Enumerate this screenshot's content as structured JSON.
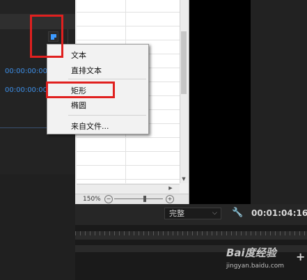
{
  "left_panel": {
    "timecodes": [
      "00:00:00:00",
      "00:00:00:00"
    ]
  },
  "context_menu": {
    "items": {
      "text": "文本",
      "vertical_text": "直排文本",
      "rectangle": "矩形",
      "ellipse": "椭圆",
      "from_file": "来自文件..."
    }
  },
  "document": {
    "zoom": "150%"
  },
  "bottom_controls": {
    "fit_select_value": "完整",
    "duration": "00:01:04:16"
  },
  "watermark": {
    "brand": "Bai度经验",
    "url": "jingyan.baidu.com"
  },
  "icons": {
    "new_item": "new-item-icon",
    "wrench": "wrench-icon",
    "add": "plus-icon"
  },
  "colors": {
    "timecode": "#3d8ee6",
    "annotation": "#e0201f",
    "icon_accent": "#3d9bff"
  }
}
